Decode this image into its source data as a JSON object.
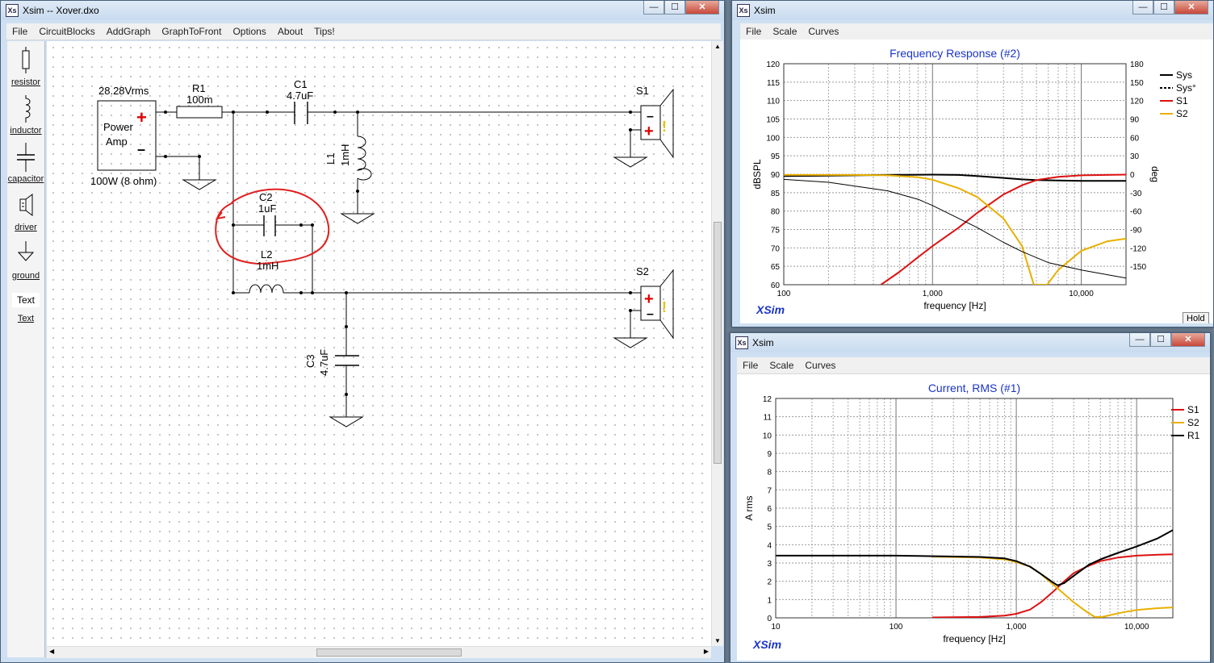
{
  "main_window": {
    "title": "Xsim -- Xover.dxo",
    "menu": [
      "File",
      "CircuitBlocks",
      "AddGraph",
      "GraphToFront",
      "Options",
      "About",
      "Tips!"
    ],
    "toolbox": [
      {
        "icon": "resistor-icon",
        "label": "resistor"
      },
      {
        "icon": "inductor-icon",
        "label": "inductor"
      },
      {
        "icon": "capacitor-icon",
        "label": "capacitor"
      },
      {
        "icon": "driver-icon",
        "label": "driver"
      },
      {
        "icon": "ground-icon",
        "label": "ground"
      },
      {
        "icon": "text-icon",
        "label": "Text",
        "preview": "Text"
      }
    ],
    "schematic": {
      "amp_voltage": "28.28Vrms",
      "amp_line1": "Power",
      "amp_line2": "Amp",
      "amp_rating": "100W (8 ohm)",
      "r1_name": "R1",
      "r1_value": "100m",
      "c1_name": "C1",
      "c1_value": "4.7uF",
      "l1_name": "L1",
      "l1_value": "1mH",
      "c2_name": "C2",
      "c2_value": "1uF",
      "l2_name": "L2",
      "l2_value": "1mH",
      "c3_name": "C3",
      "c3_value": "4.7uF",
      "s1_name": "S1",
      "s2_name": "S2",
      "annotation_color": "#e02020"
    }
  },
  "freq_window": {
    "title": "Xsim",
    "menu": [
      "File",
      "Scale",
      "Curves"
    ],
    "hold_label": "Hold",
    "watermark": "XSim",
    "chart_data": {
      "type": "line",
      "title": "Frequency Response (#2)",
      "xlabel": "frequency [Hz]",
      "ylabel": "dBSPL",
      "y2label": "deg",
      "xscale": "log",
      "xlim": [
        100,
        20000
      ],
      "ylim": [
        60,
        120
      ],
      "y2lim": [
        -180,
        180
      ],
      "x_ticks": [
        "100",
        "1,000",
        "10,000"
      ],
      "y_ticks": [
        "60",
        "65",
        "70",
        "75",
        "80",
        "85",
        "90",
        "95",
        "100",
        "105",
        "110",
        "115",
        "120"
      ],
      "y2_ticks": [
        "-150",
        "-120",
        "-90",
        "-60",
        "-30",
        "0",
        "30",
        "60",
        "90",
        "120",
        "150",
        "180"
      ],
      "grid": true,
      "legend_position": "right",
      "series": [
        {
          "name": "Sys",
          "color": "#000000",
          "style": "solid",
          "width": 2,
          "x": [
            100,
            200,
            500,
            1000,
            1500,
            2000,
            3000,
            4000,
            5000,
            7000,
            10000,
            20000
          ],
          "y": [
            89.5,
            89.6,
            89.8,
            89.9,
            89.8,
            89.5,
            89.0,
            88.6,
            88.4,
            88.3,
            88.2,
            88.2
          ]
        },
        {
          "name": "Sys°",
          "color": "#000000",
          "style": "dashed",
          "width": 1
        },
        {
          "name": "S1",
          "color": "#dd1111",
          "style": "solid",
          "width": 2,
          "x": [
            450,
            600,
            800,
            1000,
            1500,
            2000,
            3000,
            4000,
            5000,
            7000,
            10000,
            20000
          ],
          "y": [
            60,
            63.5,
            67.5,
            70.5,
            75.5,
            79.5,
            84.5,
            87,
            88.4,
            89.3,
            89.7,
            89.9
          ]
        },
        {
          "name": "S2",
          "color": "#e8b000",
          "style": "solid",
          "width": 2,
          "x": [
            100,
            300,
            500,
            800,
            1000,
            1500,
            2000,
            3000,
            4000,
            4800,
            5900,
            7000,
            10000,
            15000,
            20000
          ],
          "y": [
            89.8,
            89.8,
            89.7,
            89.2,
            88.5,
            86.2,
            83.8,
            78.0,
            70.5,
            60.0,
            60.0,
            64.0,
            69.2,
            71.8,
            72.5
          ]
        },
        {
          "name": "",
          "color": "#000000",
          "style": "solid",
          "width": 1,
          "x": [
            100,
            200,
            500,
            800,
            1000,
            1500,
            2000,
            3000,
            4000,
            6000,
            10000,
            20000
          ],
          "y": [
            88.6,
            87.8,
            85.5,
            83.2,
            81.5,
            78.0,
            75.5,
            71.5,
            69.0,
            66.0,
            64.0,
            61.8
          ]
        }
      ]
    }
  },
  "current_window": {
    "title": "Xsim",
    "menu": [
      "File",
      "Scale",
      "Curves"
    ],
    "watermark": "XSim",
    "chart_data": {
      "type": "line",
      "title": "Current, RMS (#1)",
      "xlabel": "frequency [Hz]",
      "ylabel": "A rms",
      "xscale": "log",
      "xlim": [
        10,
        20000
      ],
      "ylim": [
        0,
        12
      ],
      "x_ticks": [
        "10",
        "100",
        "1,000",
        "10,000"
      ],
      "y_ticks": [
        "0",
        "1",
        "2",
        "3",
        "4",
        "5",
        "6",
        "7",
        "8",
        "9",
        "10",
        "11",
        "12"
      ],
      "grid": true,
      "legend_position": "right",
      "series": [
        {
          "name": "S1",
          "color": "#dd1111",
          "x": [
            200,
            500,
            800,
            1000,
            1300,
            1600,
            2000,
            2500,
            3000,
            4000,
            5000,
            7000,
            10000,
            15000,
            20000
          ],
          "y": [
            0.02,
            0.05,
            0.12,
            0.22,
            0.45,
            0.85,
            1.4,
            2.0,
            2.45,
            2.85,
            3.1,
            3.3,
            3.4,
            3.45,
            3.47
          ]
        },
        {
          "name": "S2",
          "color": "#e8b000",
          "x": [
            200,
            500,
            800,
            1000,
            1300,
            1600,
            2000,
            2500,
            3000,
            3800,
            4500,
            5200,
            6000,
            8000,
            10000,
            15000,
            20000
          ],
          "y": [
            3.35,
            3.3,
            3.2,
            3.05,
            2.8,
            2.4,
            1.85,
            1.3,
            0.85,
            0.35,
            0.05,
            0.05,
            0.15,
            0.32,
            0.43,
            0.53,
            0.57
          ]
        },
        {
          "name": "R1",
          "color": "#000000",
          "x": [
            10,
            100,
            500,
            800,
            1000,
            1300,
            1600,
            2000,
            2200,
            2500,
            3000,
            4000,
            5000,
            7000,
            10000,
            15000,
            20000
          ],
          "y": [
            3.4,
            3.4,
            3.33,
            3.25,
            3.1,
            2.8,
            2.4,
            1.95,
            1.78,
            1.9,
            2.3,
            2.9,
            3.2,
            3.55,
            3.9,
            4.35,
            4.8
          ]
        }
      ]
    }
  }
}
